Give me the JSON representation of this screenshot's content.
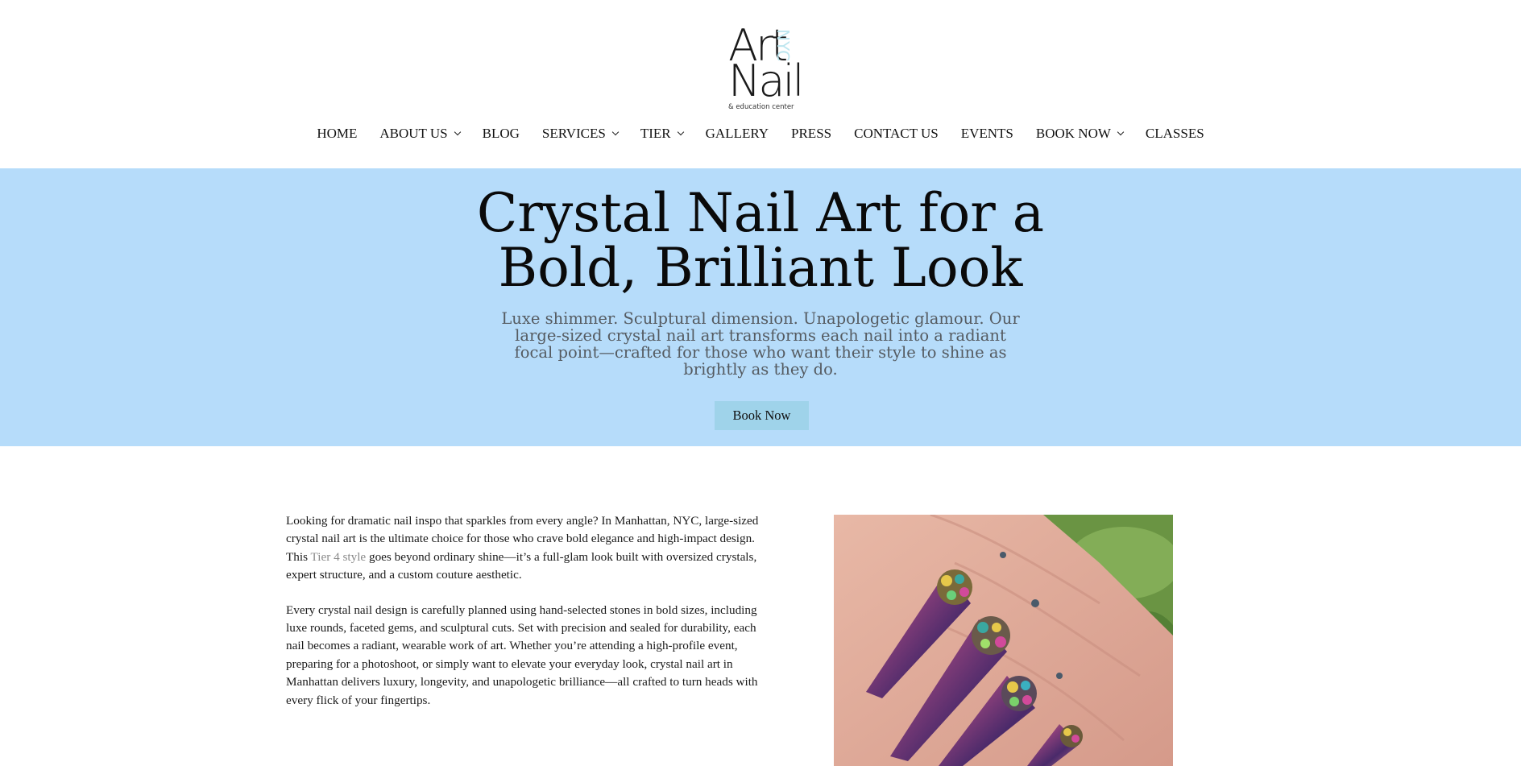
{
  "brand": {
    "logo_art": "Art",
    "logo_nail": "Nail",
    "logo_nyc": "NYC",
    "logo_tagline": "& education center"
  },
  "nav": {
    "items": [
      {
        "label": "HOME",
        "dropdown": false
      },
      {
        "label": "ABOUT US",
        "dropdown": true
      },
      {
        "label": "BLOG",
        "dropdown": false
      },
      {
        "label": "SERVICES",
        "dropdown": true
      },
      {
        "label": "TIER",
        "dropdown": true
      },
      {
        "label": "GALLERY",
        "dropdown": false
      },
      {
        "label": "PRESS",
        "dropdown": false
      },
      {
        "label": "CONTACT US",
        "dropdown": false
      },
      {
        "label": "EVENTS",
        "dropdown": false
      },
      {
        "label": "BOOK NOW",
        "dropdown": true
      },
      {
        "label": "CLASSES",
        "dropdown": false
      }
    ]
  },
  "hero": {
    "title_line1": "Crystal Nail Art for a",
    "title_line2": "Bold, Brilliant Look",
    "subtitle": "Luxe shimmer. Sculptural dimension. Unapologetic glamour. Our large-sized crystal nail art transforms each nail into a radiant focal point—crafted for those who want their style to shine as brightly as they do.",
    "button_label": "Book Now",
    "background_color": "#b6dcfa",
    "button_color": "#9fd3ea"
  },
  "content": {
    "para1_before": "Looking for dramatic nail inspo that sparkles from every angle? In Manhattan, NYC, large-sized crystal nail art is the ultimate choice for those who crave bold elegance and high-impact design. This ",
    "para1_link": "Tier 4 style",
    "para1_after": " goes beyond ordinary shine—it’s a full-glam look built with oversized crystals, expert structure, and a custom couture aesthetic.",
    "para2": "Every crystal nail design is carefully planned using hand-selected stones in bold sizes, including luxe rounds, faceted gems, and sculptural cuts. Set with precision and sealed for durability, each nail becomes a radiant, wearable work of art. Whether you’re attending a high-profile event, preparing for a photoshoot, or simply want to elevate your everyday look, crystal nail art in Manhattan delivers luxury, longevity, and unapologetic brilliance—all crafted to turn heads with every flick of your fingertips."
  },
  "image": {
    "subject": "hand with long stiletto chrome nails decorated with large multicolor crystals"
  }
}
